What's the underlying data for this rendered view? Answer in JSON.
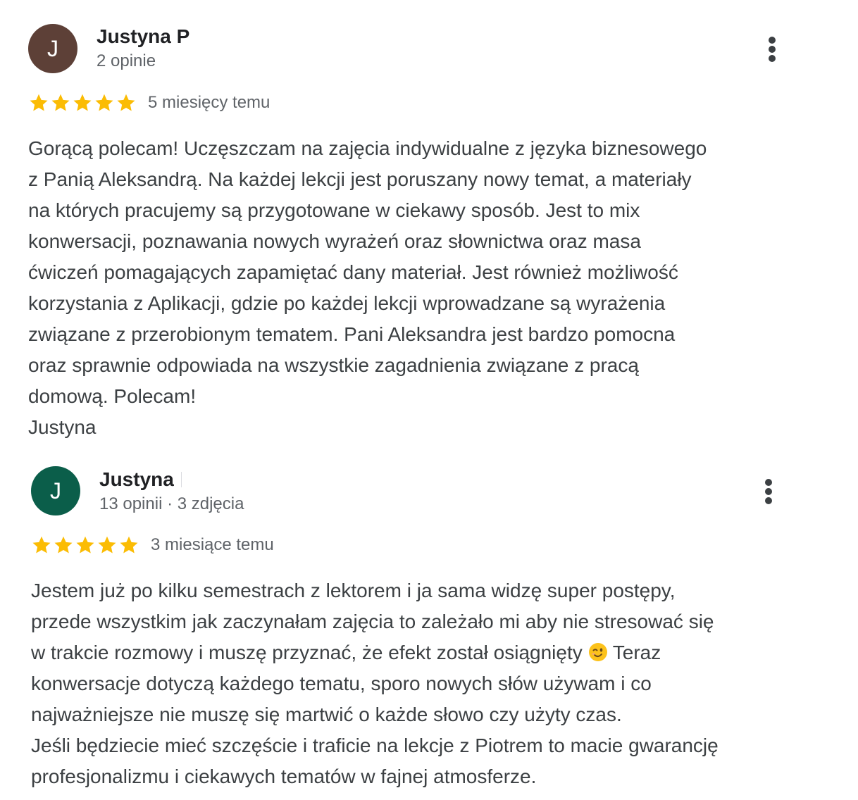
{
  "reviews": [
    {
      "avatar_letter": "J",
      "avatar_color": "#5d4037",
      "name": "Justyna P",
      "meta": "2 opinie",
      "rating": 5,
      "date": "5 miesięcy temu",
      "text": "Gorącą polecam! Uczęszczam na zajęcia indywidualne z języka biznesowego\nz Panią Aleksandrą. Na każdej lekcji jest poruszany nowy temat, a materiały\nna których pracujemy są przygotowane w ciekawy sposób. Jest to mix\nkonwersacji, poznawania nowych wyrażeń oraz słownictwa oraz masa\nćwiczeń pomagających zapamiętać dany materiał. Jest również możliwość\nkorzystania z Aplikacji, gdzie po każdej lekcji wprowadzane są wyrażenia\nzwiązane z przerobionym tematem. Pani Aleksandra jest bardzo pomocna\noraz sprawnie odpowiada na wszystkie zagadnienia związane z pracą\ndomową. Polecam!\nJustyna"
    },
    {
      "avatar_letter": "J",
      "avatar_color": "#0b5e4a",
      "name": "Justyna",
      "meta": "13 opinii · 3 zdjęcia",
      "rating": 5,
      "date": "3 miesiące temu",
      "text_part1": "Jestem już po kilku semestrach z lektorem i ja sama widzę super postępy,\nprzede wszystkim jak zaczynałam zajęcia to zależało mi aby nie stresować się\nw trakcie rozmowy i muszę przyznać, że efekt został osiągnięty ",
      "emoji_name": "winking-face-emoji",
      "text_part2": " Teraz\nkonwersacje dotyczą każdego tematu, sporo nowych słów używam i co\nnajważniejsze nie muszę się martwić o każde słowo czy użyty czas.\nJeśli będziecie mieć szczęście i traficie na lekcje z Piotrem to macie gwarancję\nprofesjonalizmu i ciekawych tematów w fajnej atmosferze."
    }
  ],
  "colors": {
    "star": "#fbbc04",
    "name": "#202124",
    "meta": "#5f6368",
    "text": "#3c4043"
  },
  "icons": {
    "more": "more-vert-icon",
    "star": "star-icon"
  }
}
